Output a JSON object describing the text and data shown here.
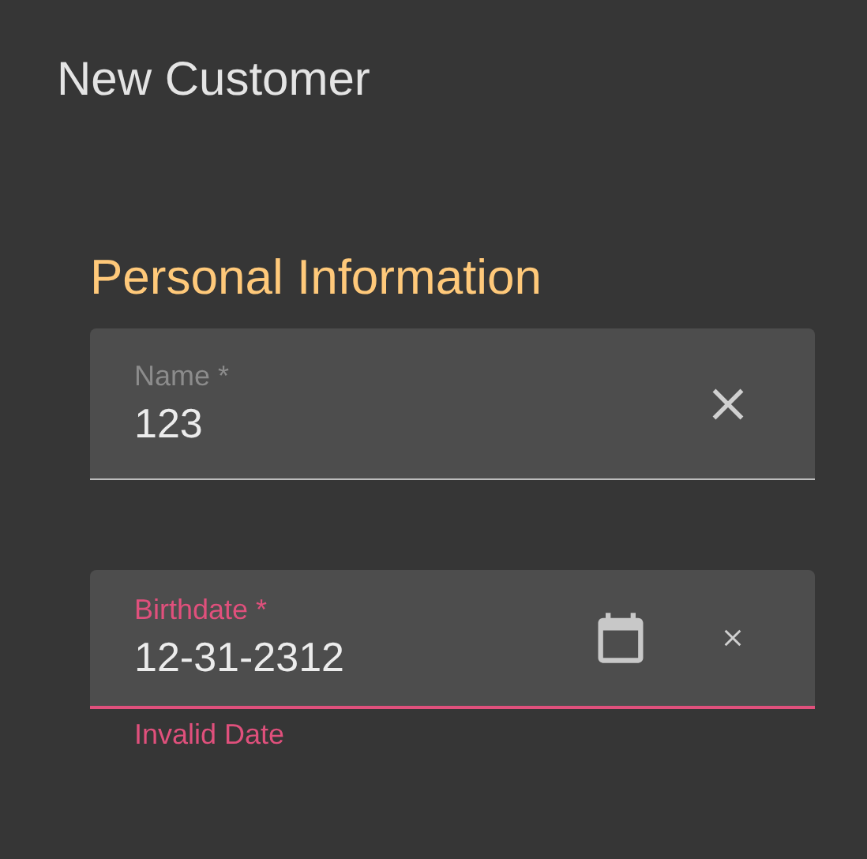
{
  "title": "New Customer",
  "section": {
    "heading": "Personal Information"
  },
  "fields": [
    {
      "kind": "text",
      "label": "Name *",
      "value": "123",
      "error": false
    },
    {
      "kind": "date",
      "label": "Birthdate *",
      "value": "12-31-2312",
      "error": true,
      "helper": "Invalid Date"
    }
  ]
}
